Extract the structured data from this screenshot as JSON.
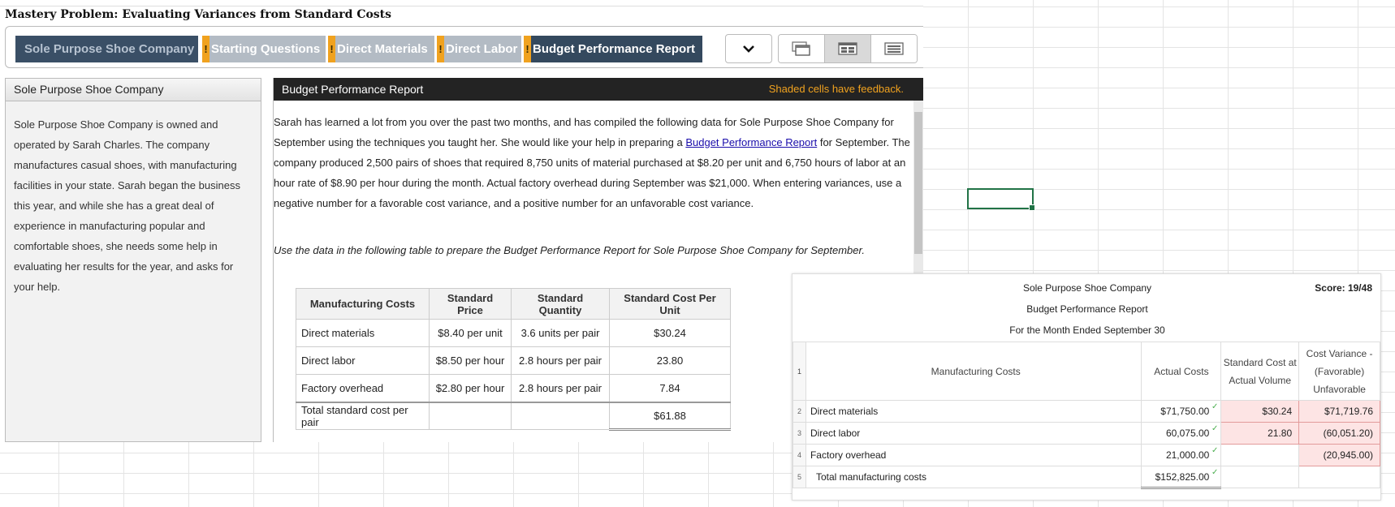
{
  "page_title": "Mastery Problem: Evaluating Variances from Standard Costs",
  "tabs": [
    {
      "label": "Sole Purpose Shoe Company",
      "flag": ""
    },
    {
      "label": "Starting Questions",
      "flag": "!"
    },
    {
      "label": "Direct Materials",
      "flag": "!"
    },
    {
      "label": "Direct Labor",
      "flag": "!"
    },
    {
      "label": "Budget Performance Report",
      "flag": "!"
    }
  ],
  "sidebar": {
    "title": "Sole Purpose Shoe Company",
    "body": "Sole Purpose Shoe Company is owned and operated by Sarah Charles. The company manufactures casual shoes, with manufacturing facilities in your state. Sarah began the business this year, and while she has a great deal of experience in manufacturing popular and comfortable shoes, she needs some help in evaluating her results for the year, and asks for your help."
  },
  "content": {
    "title": "Budget Performance Report",
    "feedback_note": "Shaded cells have feedback.",
    "para_a": "Sarah has learned a lot from you over the past two months, and has compiled the following data for Sole Purpose Shoe Company for September using the techniques you taught her. She would like your help in preparing a ",
    "para_link": "Budget Performance Report",
    "para_b": " for September. The company produced 2,500 pairs of shoes that required 8,750 units of material purchased at $8.20 per unit and 6,750 hours of labor at an hour rate of $8.90 per hour during the month. Actual factory overhead during September was $21,000. When entering variances, use a negative number for a favorable cost variance, and a positive number for an unfavorable cost variance.",
    "instruction": "Use the data in the following table to prepare the Budget Performance Report for Sole Purpose Shoe Company for September."
  },
  "standards_table": {
    "headers": [
      "Manufacturing Costs",
      "Standard Price",
      "Standard Quantity",
      "Standard Cost Per Unit"
    ],
    "rows": [
      [
        "Direct materials",
        "$8.40 per unit",
        "3.6 units per pair",
        "$30.24"
      ],
      [
        "Direct labor",
        "$8.50 per hour",
        "2.8 hours per pair",
        "23.80"
      ],
      [
        "Factory overhead",
        "$2.80 per hour",
        "2.8 hours per pair",
        "7.84"
      ]
    ],
    "total_label": "Total standard cost per pair",
    "total_value": "$61.88"
  },
  "report": {
    "company": "Sole Purpose Shoe Company",
    "title": "Budget Performance Report",
    "period": "For the Month Ended September 30",
    "score": "Score: 19/48",
    "row_numbers": [
      "1",
      "2",
      "3",
      "4",
      "5"
    ],
    "headers": {
      "costs": "Manufacturing Costs",
      "actual": "Actual Costs",
      "std1": "Standard Cost at",
      "std2": "Actual Volume",
      "var1": "Cost Variance -",
      "var2": "(Favorable)",
      "var3": "Unfavorable"
    },
    "rows": [
      {
        "label": "Direct materials",
        "actual": "$71,750.00",
        "standard": "$30.24",
        "variance": "$71,719.76"
      },
      {
        "label": "Direct labor",
        "actual": "60,075.00",
        "standard": "21.80",
        "variance": "(60,051.20)"
      },
      {
        "label": "Factory overhead",
        "actual": "21,000.00",
        "standard": "",
        "variance": "(20,945.00)"
      },
      {
        "label": "Total manufacturing costs",
        "actual": "$152,825.00",
        "standard": "",
        "variance": ""
      }
    ],
    "check_mark": "✓"
  }
}
